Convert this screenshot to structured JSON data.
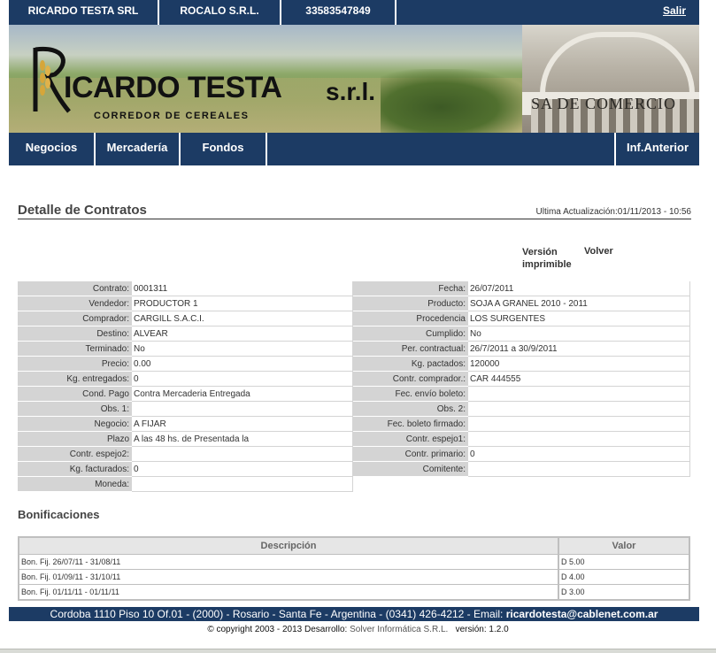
{
  "topbar": {
    "cells": [
      "RICARDO TESTA SRL",
      "ROCALO S.R.L.",
      "33583547849"
    ],
    "logout": "Salir"
  },
  "banner": {
    "logo_name": "ICARDO TESTA",
    "logo_srl": "s.r.l.",
    "logo_sub": "CORREDOR DE CEREALES",
    "building_text": "SA DE COMERCIO"
  },
  "nav": {
    "items": [
      "Negocios",
      "Mercadería",
      "Fondos"
    ],
    "right": "Inf.Anterior"
  },
  "page": {
    "title": "Detalle de Contratos",
    "last_update": "Ultima Actualización:01/11/2013 - 10:56",
    "printable": "Versión imprimible",
    "back": "Volver"
  },
  "details_left": [
    {
      "label": "Contrato:",
      "value": "0001311"
    },
    {
      "label": "Vendedor:",
      "value": "PRODUCTOR 1"
    },
    {
      "label": "Comprador:",
      "value": "CARGILL S.A.C.I."
    },
    {
      "label": "Destino:",
      "value": "ALVEAR"
    },
    {
      "label": "Terminado:",
      "value": "No"
    },
    {
      "label": "Precio:",
      "value": "0.00"
    },
    {
      "label": "Kg. entregados:",
      "value": "0"
    },
    {
      "label": "Cond. Pago",
      "value": "Contra Mercaderia Entregada"
    },
    {
      "label": "Obs. 1:",
      "value": ""
    },
    {
      "label": "Negocio:",
      "value": "A FIJAR"
    },
    {
      "label": "Plazo",
      "value": "A las 48 hs. de Presentada la"
    },
    {
      "label": "Contr. espejo2:",
      "value": ""
    },
    {
      "label": "Kg. facturados:",
      "value": "0"
    },
    {
      "label": "Moneda:",
      "value": ""
    }
  ],
  "details_right": [
    {
      "label": "Fecha:",
      "value": "26/07/2011"
    },
    {
      "label": "Producto:",
      "value": "SOJA A GRANEL 2010 - 2011"
    },
    {
      "label": "Procedencia",
      "value": "LOS SURGENTES"
    },
    {
      "label": "Cumplido:",
      "value": "No"
    },
    {
      "label": "Per. contractual:",
      "value": "26/7/2011 a 30/9/2011"
    },
    {
      "label": "Kg. pactados:",
      "value": "120000"
    },
    {
      "label": "Contr. comprador.:",
      "value": "CAR 444555"
    },
    {
      "label": "Fec. envío boleto:",
      "value": ""
    },
    {
      "label": "Obs. 2:",
      "value": ""
    },
    {
      "label": "Fec. boleto firmado:",
      "value": ""
    },
    {
      "label": "Contr. espejo1:",
      "value": ""
    },
    {
      "label": "Contr. primario:",
      "value": "0"
    },
    {
      "label": "Comitente:",
      "value": ""
    }
  ],
  "bonificaciones": {
    "title": "Bonificaciones",
    "headers": [
      "Descripción",
      "Valor"
    ],
    "rows": [
      {
        "desc": "Bon. Fij. 26/07/11 - 31/08/11",
        "valor": "D 5.00"
      },
      {
        "desc": "Bon. Fij. 01/09/11 - 31/10/11",
        "valor": "D 4.00"
      },
      {
        "desc": "Bon. Fij. 01/11/11 - 01/11/11",
        "valor": "D 3.00"
      }
    ]
  },
  "footer": {
    "address": "Cordoba 1110 Piso 10 Of.01 - (2000) - Rosario - Santa Fe - Argentina - (0341) 426-4212 - Email: ",
    "email": "ricardotesta@cablenet.com.ar",
    "copyright": "© copyright 2003 - 2013 Desarrollo: ",
    "developer": "Solver Informática S.R.L.",
    "version": "versión: 1.2.0"
  }
}
